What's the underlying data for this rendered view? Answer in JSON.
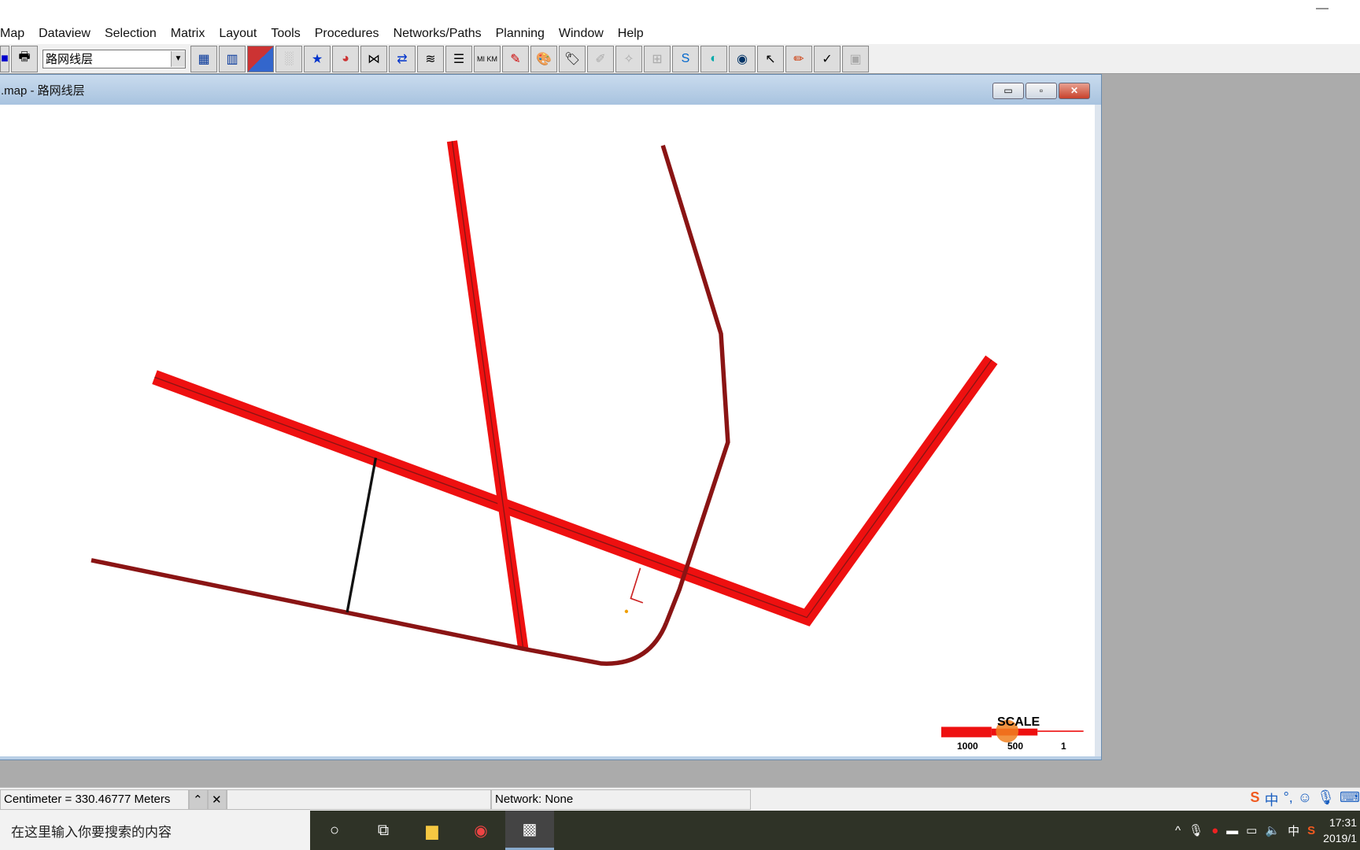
{
  "menu": [
    "Map",
    "Dataview",
    "Selection",
    "Matrix",
    "Layout",
    "Tools",
    "Procedures",
    "Networks/Paths",
    "Planning",
    "Window",
    "Help"
  ],
  "toolbar": {
    "layer_select": "路网线层"
  },
  "window": {
    "title": ".map - 路网线层",
    "minimize": "▭",
    "maximize": "▫",
    "close": "✕"
  },
  "scale": {
    "title": "SCALE",
    "labels": [
      "1000",
      "500",
      "1"
    ]
  },
  "colors": {
    "major_road": "#ee1010",
    "minor_road": "#8a1414",
    "connector": "#111111"
  },
  "status": {
    "scale_text": "Centimeter = 330.46777 Meters",
    "network": "Network: None"
  },
  "taskbar": {
    "search_placeholder": "在这里输入你要搜索的内容",
    "ime": "中",
    "time": "17:31",
    "date": "2019/1"
  }
}
